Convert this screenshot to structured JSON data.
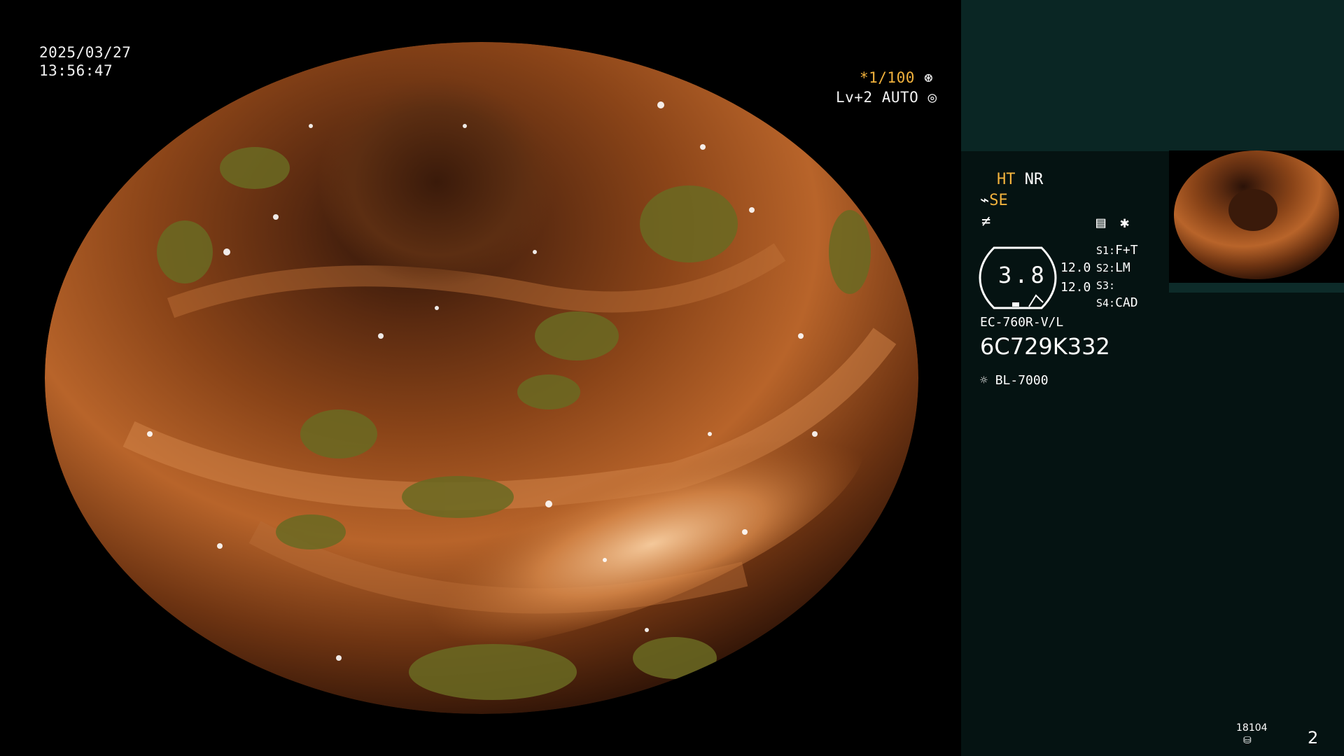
{
  "osd": {
    "date": "2025/03/27",
    "time": "13:56:47",
    "shutter": "*1/100",
    "level": "Lv+2",
    "iris_mode": "AUTO"
  },
  "panel": {
    "ht": "HT",
    "nr": "NR",
    "se": "SE",
    "zoom_value": "3.8",
    "val1": "12.0",
    "val2": "12.0",
    "switches": [
      {
        "key": "S1:",
        "value": "F+T"
      },
      {
        "key": "S2:",
        "value": "LM"
      },
      {
        "key": "S3:",
        "value": ""
      },
      {
        "key": "S4:",
        "value": "CAD"
      }
    ],
    "scope_model": "EC-760R-V/L",
    "serial": "6C729K332",
    "light_source": "BL-7000",
    "counter": "18104",
    "page_number": "2"
  },
  "colors": {
    "panel_bg": "#051312",
    "panel_top_bg": "#0a2624",
    "accent": "#f3b33d"
  }
}
